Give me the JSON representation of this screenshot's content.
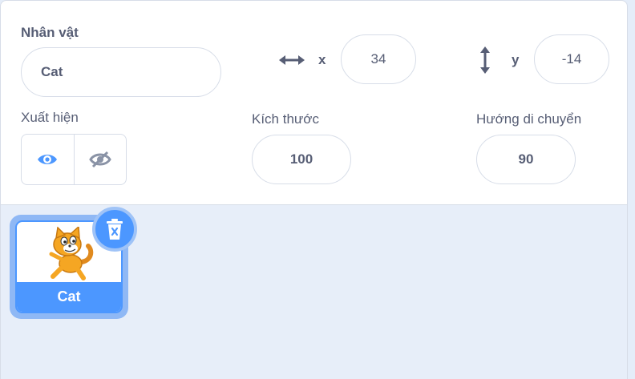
{
  "sprite": {
    "name_label": "Nhân vật",
    "name_value": "Cat",
    "x_label": "x",
    "x_value": "34",
    "y_label": "y",
    "y_value": "-14",
    "show_label": "Xuất hiện",
    "size_label": "Kích thước",
    "size_value": "100",
    "direction_label": "Hướng di chuyển",
    "direction_value": "90"
  },
  "sprite_list": {
    "items": [
      {
        "name": "Cat",
        "selected": true
      }
    ]
  },
  "colors": {
    "accent": "#4c97ff",
    "text": "#575e75",
    "border": "#d7dde8"
  },
  "icons": {
    "x_axis": "horizontal-arrows-icon",
    "y_axis": "vertical-arrows-icon",
    "show": "eye-icon",
    "hide": "eye-slash-icon",
    "delete": "trash-icon",
    "sprite_thumbnail": "cat-sprite-icon"
  }
}
